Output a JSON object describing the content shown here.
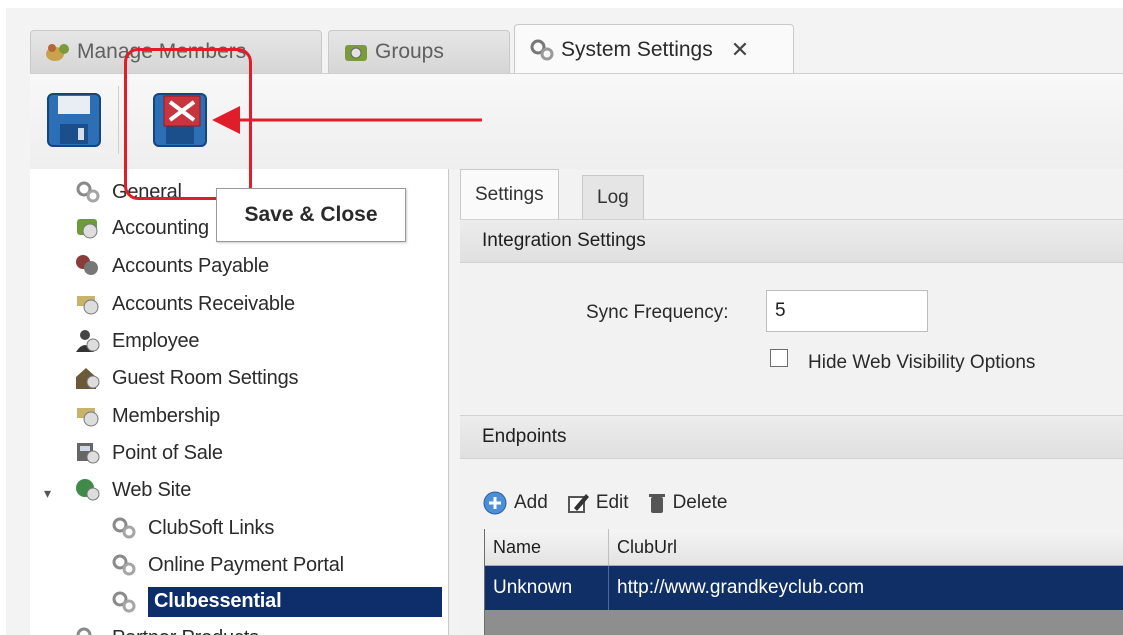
{
  "doc_tabs": [
    {
      "label": "Manage Members",
      "icon": "members-icon"
    },
    {
      "label": "Groups",
      "icon": "groups-icon"
    },
    {
      "label": "System Settings",
      "icon": "gears-icon",
      "active": true
    }
  ],
  "toolbar": {
    "save_icon": "floppy-disk-icon",
    "save_close_icon": "floppy-disk-close-icon",
    "tooltip": "Save & Close"
  },
  "tree": [
    {
      "label": "General"
    },
    {
      "label": "Accounting"
    },
    {
      "label": "Accounts Payable"
    },
    {
      "label": "Accounts Receivable"
    },
    {
      "label": "Employee"
    },
    {
      "label": "Guest Room Settings"
    },
    {
      "label": "Membership"
    },
    {
      "label": "Point of Sale"
    },
    {
      "label": "Web Site",
      "expanded": true
    },
    {
      "label": "ClubSoft Links"
    },
    {
      "label": "Online Payment Portal"
    },
    {
      "label": "Clubessential",
      "selected": true
    },
    {
      "label": "Partner Products"
    }
  ],
  "sub_tabs": [
    "Settings",
    "Log"
  ],
  "integration": {
    "header": "Integration Settings",
    "sync_label": "Sync Frequency:",
    "sync_value": "5",
    "hide_web_label": "Hide Web Visibility Options",
    "hide_web_checked": false
  },
  "endpoints": {
    "header": "Endpoints",
    "add": "Add",
    "edit": "Edit",
    "delete": "Delete",
    "columns": [
      "Name",
      "ClubUrl"
    ],
    "rows": [
      {
        "name": "Unknown",
        "url": "http://www.grandkeyclub.com"
      }
    ]
  },
  "colors": {
    "annotation": "#e11d2a",
    "selection": "#0d2e6b"
  }
}
